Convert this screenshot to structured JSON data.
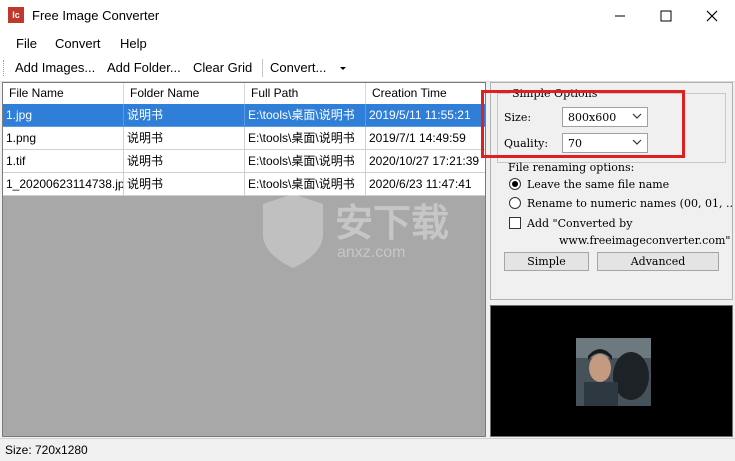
{
  "window": {
    "title": "Free Image Converter",
    "icon_text": "Ic"
  },
  "menu": [
    "File",
    "Convert",
    "Help"
  ],
  "toolbar": {
    "add_images": "Add Images...",
    "add_folder": "Add Folder...",
    "clear_grid": "Clear Grid",
    "convert": "Convert..."
  },
  "grid": {
    "columns": [
      "File Name",
      "Folder Name",
      "Full Path",
      "Creation Time"
    ],
    "rows": [
      {
        "file": "1.jpg",
        "folder": "说明书",
        "path": "E:\\tools\\桌面\\说明书",
        "time": "2019/5/11 11:55:21",
        "selected": true
      },
      {
        "file": "1.png",
        "folder": "说明书",
        "path": "E:\\tools\\桌面\\说明书",
        "time": "2019/7/1 14:49:59",
        "selected": false
      },
      {
        "file": "1.tif",
        "folder": "说明书",
        "path": "E:\\tools\\桌面\\说明书",
        "time": "2020/10/27 17:21:39",
        "selected": false
      },
      {
        "file": "1_20200623114738.jpg",
        "folder": "说明书",
        "path": "E:\\tools\\桌面\\说明书",
        "time": "2020/6/23 11:47:41",
        "selected": false
      }
    ]
  },
  "watermark": {
    "main": "安下载",
    "sub": "anxz.com"
  },
  "options": {
    "group_title": "Simple Options",
    "size_label": "Size:",
    "size_value": "800x600",
    "quality_label": "Quality:",
    "quality_value": "70",
    "renaming_title": "File renaming options:",
    "radio_same": "Leave the same file name",
    "radio_numeric": "Rename to numeric names (00, 01, ..",
    "check_add": "Add \"Converted by",
    "check_add_2": "www.freeimageconverter.com\"",
    "simple_button": "Simple",
    "advanced_button": "Advanced"
  },
  "status": {
    "text": "Size: 720x1280"
  },
  "colors": {
    "selection": "#2f7ed8",
    "highlight": "#e02020",
    "grid_bg": "#a8a8a8"
  }
}
